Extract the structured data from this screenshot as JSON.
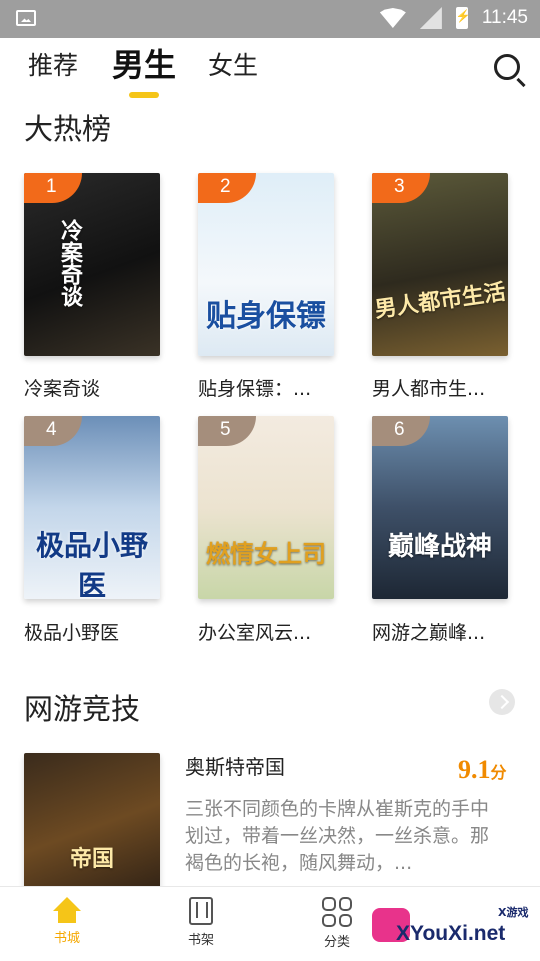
{
  "status_bar": {
    "time": "11:45"
  },
  "nav": {
    "tabs": [
      "推荐",
      "男生",
      "女生"
    ],
    "active_tab": "男生"
  },
  "hot_list": {
    "title": "大热榜",
    "books": [
      {
        "rank": "1",
        "name": "冷案奇谈",
        "cover_text": "冷案奇谈"
      },
      {
        "rank": "2",
        "name": "贴身保镖：...",
        "cover_text": "贴身保镖"
      },
      {
        "rank": "3",
        "name": "男人都市生...",
        "cover_text": "男人都市生活"
      },
      {
        "rank": "4",
        "name": "极品小野医",
        "cover_text": "极品小野医"
      },
      {
        "rank": "5",
        "name": "办公室风云...",
        "cover_text": "燃情女上司"
      },
      {
        "rank": "6",
        "name": "网游之巅峰...",
        "cover_text": "巅峰战神"
      }
    ]
  },
  "sports_section": {
    "title": "网游竞技",
    "book": {
      "title": "奥斯特帝国",
      "score": "9.1",
      "score_unit": "分",
      "description": "三张不同颜色的卡牌从崔斯克的手中划过，带着一丝决然，一丝杀意。那褐色的长袍，随风舞动，...",
      "cover_text": "帝国"
    }
  },
  "bottom_nav": {
    "items": [
      {
        "label": "书城"
      },
      {
        "label": "书架"
      },
      {
        "label": "分类"
      }
    ]
  },
  "watermark": {
    "text": "XYouXi.net",
    "small": "X游戏"
  },
  "colors": {
    "accent": "#f5c518",
    "rank_1_3": "#f26a1a",
    "rank_4_6": "#a58e7c",
    "score": "#f08a00"
  }
}
